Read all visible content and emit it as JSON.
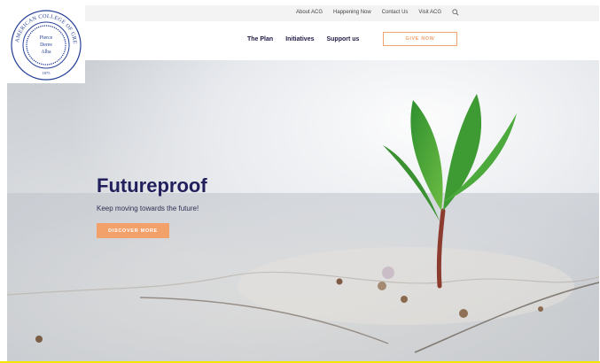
{
  "logo": {
    "arc_text": "THE AMERICAN COLLEGE OF GREECE",
    "lines": [
      "Pierce",
      "Deree",
      "Alba"
    ],
    "year": "1875"
  },
  "utility_nav": {
    "items": [
      "About ACG",
      "Happening Now",
      "Contact Us",
      "Visit ACG"
    ],
    "search_icon": "search-icon"
  },
  "main_nav": {
    "items": [
      "The Plan",
      "Initiatives",
      "Support us"
    ],
    "give_now": "GIVE NOW"
  },
  "hero": {
    "title": "Futureproof",
    "subtitle": "Keep moving towards the future!",
    "button": "DISCOVER MORE"
  },
  "colors": {
    "navy": "#221f5d",
    "orange": "#f2a16b",
    "logo_blue": "#253f96"
  }
}
